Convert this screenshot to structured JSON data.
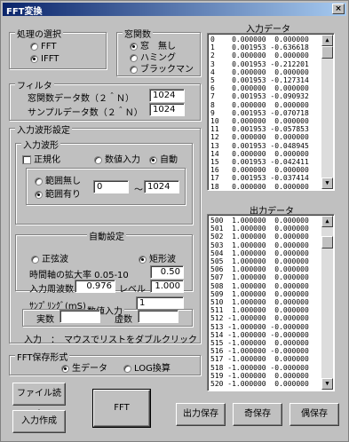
{
  "window": {
    "title": "FFT変換",
    "close_glyph": "×"
  },
  "process": {
    "legend": "処理の選択",
    "options": [
      {
        "label": "FFT",
        "selected": false
      },
      {
        "label": "IFFT",
        "selected": true
      }
    ]
  },
  "window_fn": {
    "legend": "窓関数",
    "options": [
      {
        "label": "窓　無し",
        "selected": true
      },
      {
        "label": "ハミング",
        "selected": false
      },
      {
        "label": "ブラックマン",
        "selected": false
      }
    ]
  },
  "filter": {
    "legend": "フィルタ",
    "window_size_label": "窓関数データ数（２＾Ｎ）",
    "window_size_value": "1024",
    "sample_size_label": "サンプルデータ数（２＾Ｎ）",
    "sample_size_value": "1024"
  },
  "input_settings": {
    "legend": "入力波形設定",
    "wave": {
      "legend": "入力波形",
      "normalize_label": "正規化",
      "numeric_label": "数値入力",
      "auto_label": "自動",
      "range_none_label": "範囲無し",
      "range_yes_label": "範囲有り",
      "range_from": "0",
      "range_sep": "～",
      "range_to": "1024"
    },
    "auto": {
      "legend": "自動設定",
      "sine_label": "正弦波",
      "square_label": "矩形波",
      "time_scale_label": "時間軸の拡大率 0.05-10",
      "time_scale_value": "0.50",
      "input_freq_label": "入力周波数",
      "input_freq_value": "0.976",
      "level_label": "レベル",
      "level_value": "1.000",
      "sampling_label": "ｻﾝﾌﾟﾘﾝｸﾞ(mS)",
      "sampling_value": "1"
    },
    "numeric": {
      "legend": "数値入力",
      "real_label": "実数",
      "real_value": "",
      "imag_label": "虚数",
      "imag_value": ""
    },
    "hint": "入力　：　マウスでリストをダブルクリック"
  },
  "save_format": {
    "legend": "FFT保存形式",
    "raw_label": "生データ",
    "log_label": "LOG換算"
  },
  "buttons": {
    "file_read": "ファイル読出",
    "input_create": "入力作成",
    "fft": "FFT",
    "output_save": "出力保存",
    "odd_save": "奇保存",
    "even_save": "偶保存"
  },
  "input_list": {
    "title": "入力データ",
    "rows": [
      "0    0.000000  0.000000",
      "1    0.001953 -0.636618",
      "2    0.000000  0.000000",
      "3    0.001953 -0.212201",
      "4    0.000000  0.000000",
      "5    0.001953 -0.127314",
      "6    0.000000  0.000000",
      "7    0.001953 -0.090932",
      "8    0.000000  0.000000",
      "9    0.001953 -0.070718",
      "10   0.000000  0.000000",
      "11   0.001953 -0.057853",
      "12   0.000000  0.000000",
      "13   0.001953 -0.048945",
      "14   0.000000  0.000000",
      "15   0.001953 -0.042411",
      "16   0.000000  0.000000",
      "17   0.001953 -0.037414",
      "18   0.000000  0.000000"
    ]
  },
  "output_list": {
    "title": "出力データ",
    "rows": [
      "500  1.000000  0.000000",
      "501  1.000000  0.000000",
      "502  1.000000  0.000000",
      "503  1.000000  0.000000",
      "504  1.000000  0.000000",
      "505  1.000000  0.000000",
      "506  1.000000  0.000000",
      "507  1.000000  0.000000",
      "508  1.000000  0.000000",
      "509  1.000000  0.000000",
      "510  1.000000  0.000000",
      "511  1.000000  0.000000",
      "512 -1.000000  0.000000",
      "513 -1.000000 -0.000000",
      "514 -1.000000 -0.000000",
      "515 -1.000000  0.000000",
      "516 -1.000000 -0.000000",
      "517 -1.000000  0.000000",
      "518 -1.000000 -0.000000",
      "519 -1.000000  0.000000",
      "520 -1.000000  0.000000"
    ]
  }
}
